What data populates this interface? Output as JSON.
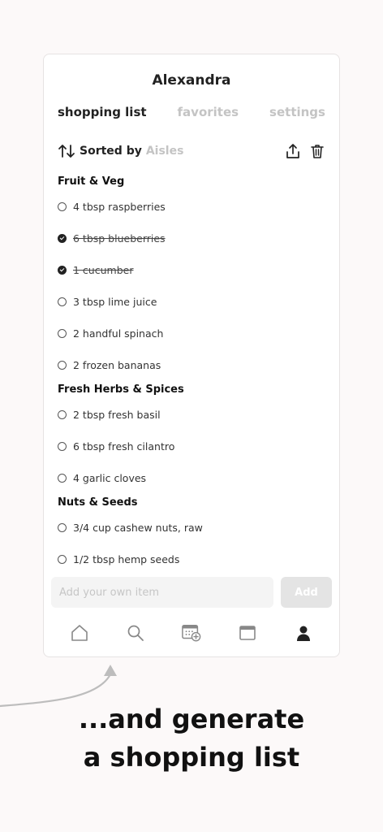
{
  "user": {
    "name": "Alexandra"
  },
  "tabs": [
    {
      "label": "shopping list",
      "active": true
    },
    {
      "label": "favorites",
      "active": false
    },
    {
      "label": "settings",
      "active": false
    }
  ],
  "sort": {
    "label": "Sorted by",
    "value": "Aisles",
    "icon": "sort-arrows-icon"
  },
  "actions": {
    "share_icon": "share-icon",
    "delete_icon": "trash-icon"
  },
  "sections": [
    {
      "title": "Fruit & Veg",
      "items": [
        {
          "text": "4 tbsp raspberries",
          "checked": false
        },
        {
          "text": "6 tbsp blueberries",
          "checked": true
        },
        {
          "text": "1 cucumber",
          "checked": true
        },
        {
          "text": "3 tbsp lime juice",
          "checked": false
        },
        {
          "text": "2 handful spinach",
          "checked": false
        },
        {
          "text": "2 frozen bananas",
          "checked": false
        }
      ]
    },
    {
      "title": "Fresh Herbs & Spices",
      "items": [
        {
          "text": "2 tbsp fresh basil",
          "checked": false
        },
        {
          "text": "6 tbsp fresh cilantro",
          "checked": false
        },
        {
          "text": "4 garlic cloves",
          "checked": false
        }
      ]
    },
    {
      "title": "Nuts & Seeds",
      "items": [
        {
          "text": "3/4 cup cashew nuts, raw",
          "checked": false
        },
        {
          "text": "1/2 tbsp hemp seeds",
          "checked": false
        }
      ]
    }
  ],
  "add_item": {
    "placeholder": "Add your own item",
    "value": "",
    "button_label": "Add"
  },
  "bottom_nav": [
    {
      "name": "home-icon"
    },
    {
      "name": "search-icon"
    },
    {
      "name": "calendar-add-icon"
    },
    {
      "name": "window-icon"
    },
    {
      "name": "profile-icon"
    }
  ],
  "caption": {
    "line1": "...and generate",
    "line2": "a shopping list"
  },
  "colors": {
    "background": "#fcf9f9",
    "text": "#1a1a1a",
    "inactive": "#c4c4c4",
    "accent": "#222222"
  }
}
